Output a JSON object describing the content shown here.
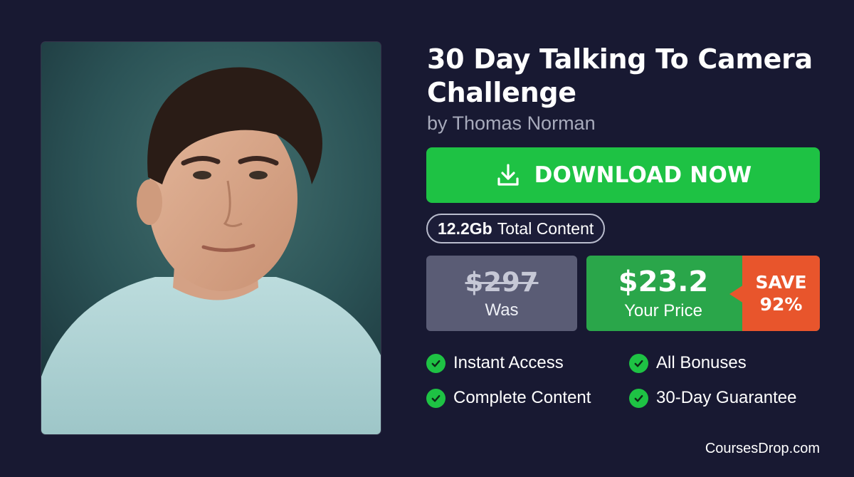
{
  "course": {
    "title": "30 Day Talking To Camera Challenge",
    "author": "by Thomas Norman"
  },
  "download": {
    "label": "DOWNLOAD NOW",
    "icon": "download-icon"
  },
  "content_size": {
    "value": "12.2Gb",
    "label": "Total Content"
  },
  "pricing": {
    "old_price": "$297",
    "old_label": "Was",
    "new_price": "$23.2",
    "new_label": "Your Price",
    "save_line1": "SAVE",
    "save_line2": "92%"
  },
  "features": [
    {
      "label": "Instant Access",
      "icon": "check-circle-icon"
    },
    {
      "label": "All Bonuses",
      "icon": "check-circle-icon"
    },
    {
      "label": "Complete Content",
      "icon": "check-circle-icon"
    },
    {
      "label": "30-Day Guarantee",
      "icon": "check-circle-icon"
    }
  ],
  "footer": {
    "site": "CoursesDrop.com"
  },
  "colors": {
    "background": "#181932",
    "accent_green": "#1ec244",
    "price_green": "#2aa64a",
    "save_orange": "#e8552c",
    "was_gray": "#5a5c75"
  }
}
